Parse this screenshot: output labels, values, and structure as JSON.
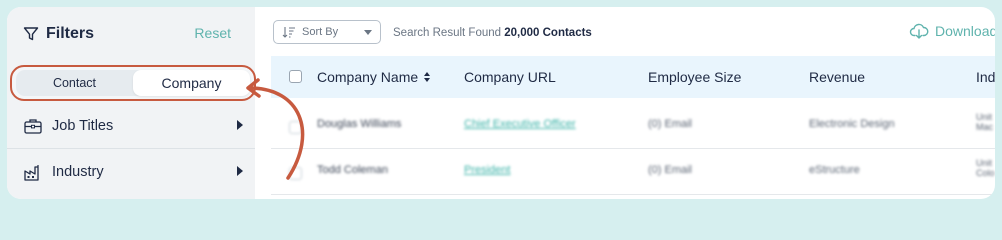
{
  "sidebar": {
    "title": "Filters",
    "reset_label": "Reset",
    "toggle": {
      "options": [
        "Contact",
        "Company"
      ],
      "selected": "Company"
    },
    "items": [
      {
        "label": "Job Titles",
        "icon": "briefcase-icon"
      },
      {
        "label": "Industry",
        "icon": "factory-icon"
      }
    ]
  },
  "toolbar": {
    "sort_label": "Sort By",
    "result_prefix": "Search Result Found",
    "result_count": "20,000 Contacts",
    "download_label": "Download"
  },
  "table": {
    "columns": [
      "Company Name",
      "Company URL",
      "Employee Size",
      "Revenue",
      "Indu"
    ],
    "rows": [
      {
        "name": "Douglas Williams",
        "url": "Chief Executive Officer",
        "size": "(0) Email",
        "revenue": "Electronic Design",
        "industry": [
          "Unit",
          "Mac"
        ]
      },
      {
        "name": "Todd Coleman",
        "url": "President",
        "size": "(0) Email",
        "revenue": "eStructure",
        "industry": [
          "Unit",
          "Colo"
        ]
      }
    ]
  },
  "colors": {
    "accent": "#5fb3ad",
    "highlight": "#c75a3f",
    "header_bg": "#e9f5fd",
    "sidebar_bg": "#f1f3f5",
    "outer_bg": "#d6efef"
  }
}
